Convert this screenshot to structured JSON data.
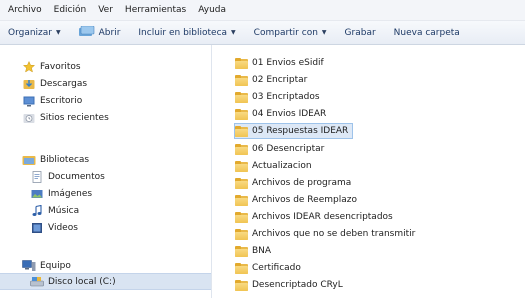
{
  "menubar": {
    "items": [
      "Archivo",
      "Edición",
      "Ver",
      "Herramientas",
      "Ayuda"
    ]
  },
  "toolbar": {
    "organize": "Organizar",
    "open": "Abrir",
    "include": "Incluir en biblioteca",
    "share": "Compartir con",
    "burn": "Grabar",
    "new_folder": "Nueva carpeta"
  },
  "nav": {
    "favorites_title": "Favoritos",
    "favorites": [
      "Descargas",
      "Escritorio",
      "Sitios recientes"
    ],
    "libraries_title": "Bibliotecas",
    "libraries": [
      "Documentos",
      "Imágenes",
      "Música",
      "Videos"
    ],
    "computer_title": "Equipo",
    "computer": [
      "Disco local (C:)"
    ]
  },
  "files": {
    "folders": [
      "01 Envios eSidif",
      "02 Encriptar",
      "03 Encriptados",
      "04 Envios IDEAR",
      "05 Respuestas IDEAR",
      "06 Desencriptar",
      "Actualizacion",
      "Archivos de programa",
      "Archivos de Reemplazo",
      "Archivos IDEAR desencriptados",
      "Archivos que no se deben transmitir",
      "BNA",
      "Certificado",
      "Desencriptado CRyL"
    ]
  },
  "colors": {
    "selection": "#dde8f6",
    "selection_border": "#9ec3ea",
    "toolbar_text": "#1e3a66"
  }
}
